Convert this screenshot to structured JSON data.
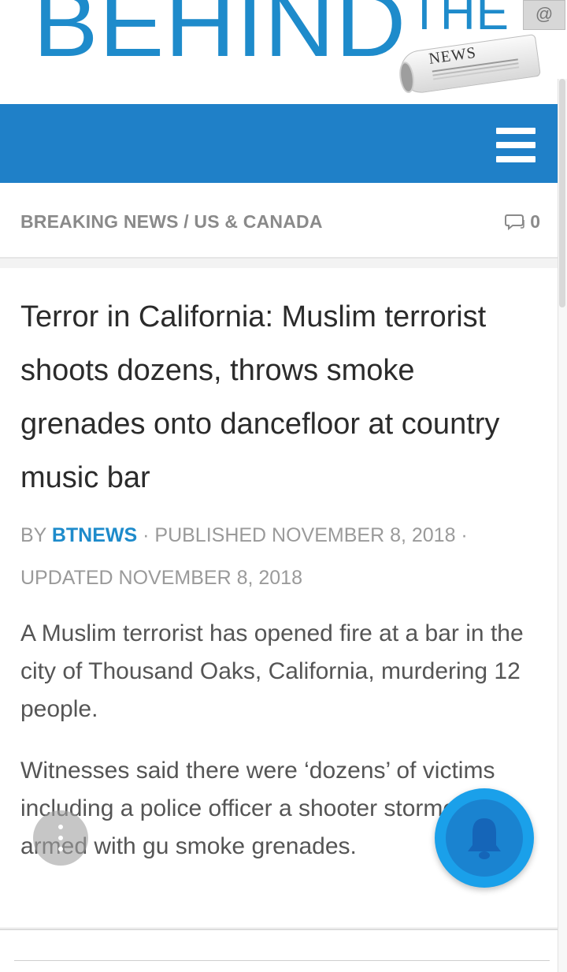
{
  "logo": {
    "behind": "BEHIND",
    "the": "THE",
    "news": "NEWS",
    "corner_icon": "@"
  },
  "nav": {
    "menu_icon": "hamburger-icon"
  },
  "breadcrumb": {
    "text": "BREAKING NEWS / US & CANADA",
    "comment_icon": "comment-icon",
    "comment_count": "0"
  },
  "article": {
    "title": "Terror in California: Muslim terrorist shoots dozens, throws smoke grenades onto dancefloor at country music bar",
    "meta": {
      "by": "BY ",
      "author": "BTNEWS",
      "published": " · PUBLISHED NOVEMBER 8, 2018 · ",
      "updated": "UPDATED NOVEMBER 8, 2018"
    },
    "paragraphs": [
      "A Muslim terrorist has opened fire at a bar in the city of Thousand Oaks, California, murdering 12 people.",
      "Witnesses said there were ‘dozens’ of victims including a police officer a shooter stormed in armed with gu smoke grenades."
    ]
  },
  "widgets": {
    "share_icon": "more-vertical-icon",
    "bell_icon": "bell-icon"
  },
  "colors": {
    "brand_blue": "#1e8bcb",
    "nav_blue": "#1f80c8",
    "bell_blue": "#1aa0ea"
  }
}
